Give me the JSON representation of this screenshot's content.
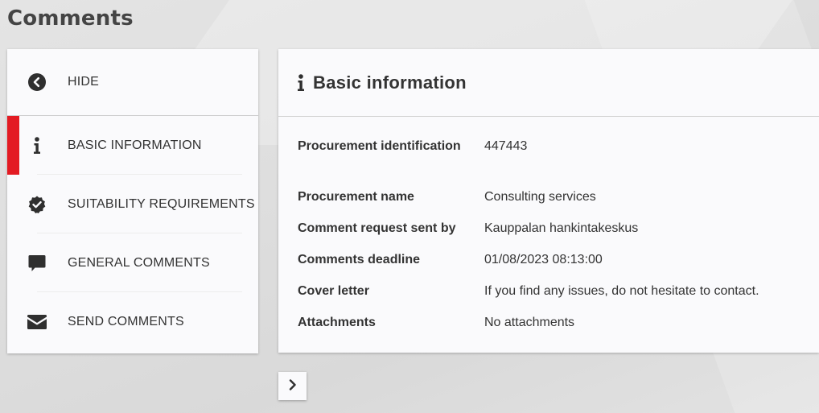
{
  "page": {
    "title": "Comments"
  },
  "sidebar": {
    "items": [
      {
        "label": "HIDE",
        "icon": "chevron-left-circle-icon"
      },
      {
        "label": "BASIC INFORMATION",
        "icon": "info-icon",
        "active": true
      },
      {
        "label": "SUITABILITY REQUIREMENTS",
        "icon": "badge-check-icon"
      },
      {
        "label": "GENERAL COMMENTS",
        "icon": "comment-icon"
      },
      {
        "label": "SEND COMMENTS",
        "icon": "envelope-icon"
      }
    ],
    "active_color": "#e31b23"
  },
  "panel": {
    "title": "Basic information",
    "icon": "info-icon",
    "rows": [
      {
        "label": "Procurement identification",
        "value": "447443"
      },
      {
        "label": "Procurement name",
        "value": "Consulting services"
      },
      {
        "label": "Comment request sent by",
        "value": "Kauppalan hankintakeskus"
      },
      {
        "label": "Comments deadline",
        "value": "01/08/2023 08:13:00"
      },
      {
        "label": "Cover letter",
        "value": "If you find any issues, do not hesitate to contact."
      },
      {
        "label": "Attachments",
        "value": "No attachments"
      }
    ]
  },
  "pager": {
    "next_icon": "chevron-right-icon"
  }
}
